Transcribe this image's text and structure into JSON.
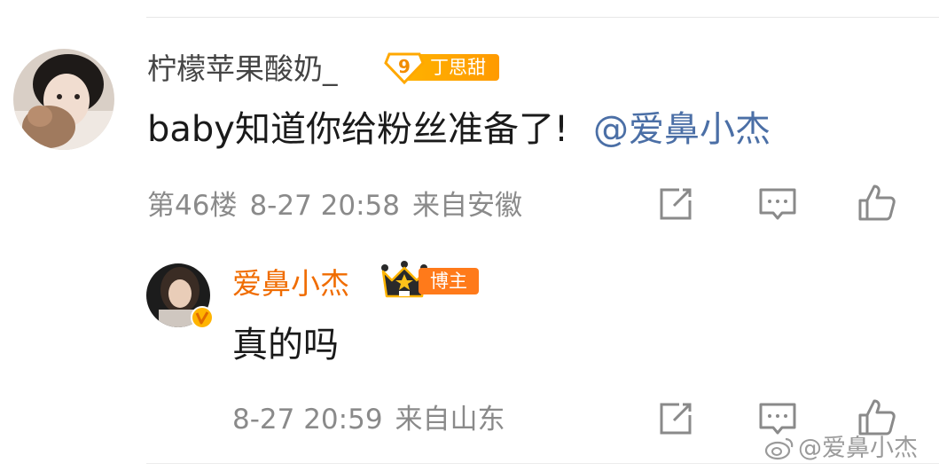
{
  "comment": {
    "username": "柠檬苹果酸奶_",
    "fan_badge": {
      "level": "9",
      "label": "丁思甜"
    },
    "text": "baby知道你给粉丝准备了!",
    "mention": "@爱鼻小杰",
    "floor": "第46楼",
    "time": "8-27 20:58",
    "location": "来自安徽"
  },
  "reply": {
    "username": "爱鼻小杰",
    "badge_label": "博主",
    "text": "真的吗",
    "time": "8-27 20:59",
    "location": "来自山东"
  },
  "watermark": {
    "text": "@爱鼻小杰"
  },
  "colors": {
    "blogger_name": "#f06c00",
    "mention": "#4b6fa6",
    "meta": "#8a8a8a",
    "icon": "#8a8a8a",
    "fan_badge": "#ffa800",
    "blogger_badge": "#ff7a1a"
  },
  "icons": [
    "share-icon",
    "comment-icon",
    "like-icon",
    "verified-icon",
    "crown-icon",
    "weibo-logo-icon"
  ]
}
